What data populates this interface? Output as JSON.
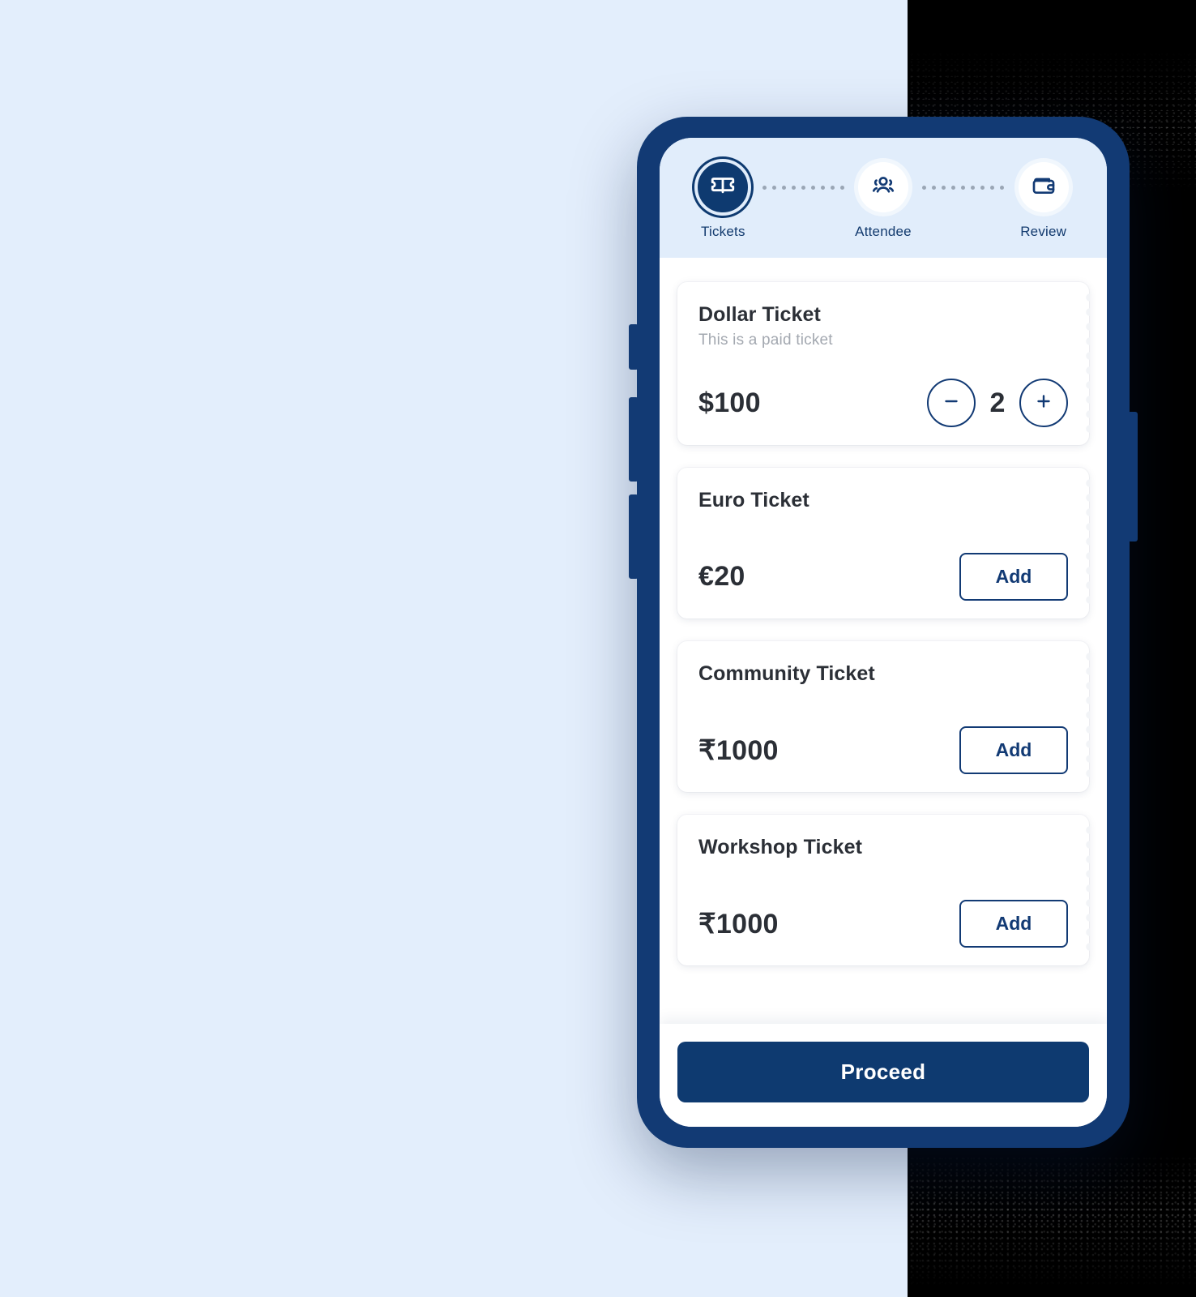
{
  "stepper": {
    "steps": [
      {
        "label": "Tickets",
        "icon": "ticket-icon",
        "state": "active"
      },
      {
        "label": "Attendee",
        "icon": "users-icon",
        "state": "idle"
      },
      {
        "label": "Review",
        "icon": "wallet-icon",
        "state": "idle"
      }
    ]
  },
  "tickets": [
    {
      "title": "Dollar Ticket",
      "subtitle": "This is a paid ticket",
      "price": "$100",
      "control": "stepper",
      "quantity": "2",
      "decrement_icon": "minus-icon",
      "increment_icon": "plus-icon"
    },
    {
      "title": "Euro Ticket",
      "subtitle": "",
      "price": "€20",
      "control": "add",
      "add_label": "Add"
    },
    {
      "title": "Community Ticket",
      "subtitle": "",
      "price": "₹1000",
      "control": "add",
      "add_label": "Add"
    },
    {
      "title": "Workshop Ticket",
      "subtitle": "",
      "price": "₹1000",
      "control": "add",
      "add_label": "Add"
    }
  ],
  "footer": {
    "proceed_label": "Proceed"
  },
  "colors": {
    "brand_navy": "#0e3a70",
    "frame_navy": "#123a74",
    "header_bg": "#e1edfb",
    "page_bg": "#e3eefc",
    "right_panel": "#000000",
    "muted_text": "#a3a8b0",
    "title_text": "#2b2f36"
  }
}
